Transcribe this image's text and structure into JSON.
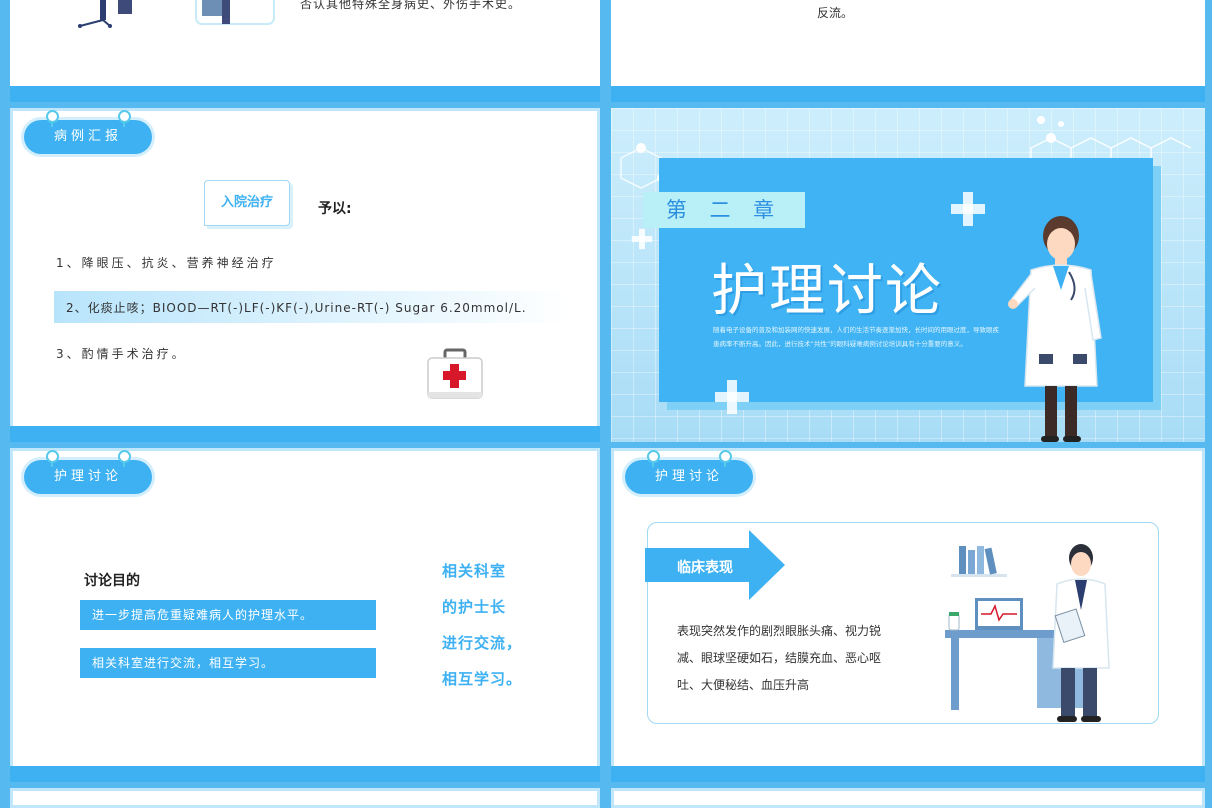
{
  "slide_top_left": {
    "text": "否认其他特殊全身病史、外伤手术史。"
  },
  "slide_top_right": {
    "text": "反流。"
  },
  "slide_case": {
    "tag": "病例汇报",
    "box_label": "入院治疗",
    "give": "予以:",
    "items": [
      "1、降眼压、抗炎、营养神经治疗",
      "2、化痰止咳；BIOOD—RT(-)LF(-)KF(-),Urine-RT(-) Sugar 6.20mmol/L.",
      "3、酌情手术治疗。"
    ]
  },
  "slide_chapter": {
    "chapter_label": "第 二 章",
    "title": "护理讨论",
    "desc_line1": "随着电子设备的普及和加装网的快速发展，人们的生活节奏逐渐加快，长时间的用眼过度，导致眼疾",
    "desc_line2": "患病率不断升高。因此，进行技术“共性”的眼科疑难病例讨论培训具有十分重要的意义。"
  },
  "slide_discuss": {
    "tag": "护理讨论",
    "heading": "讨论目的",
    "bar1": "进一步提高危重疑难病人的护理水平。",
    "bar2": "相关科室进行交流，相互学习。",
    "side_lines": [
      "相关科室",
      "的护士长",
      "进行交流，",
      "相互学习。"
    ]
  },
  "slide_clinical": {
    "tag": "护理讨论",
    "arrow_label": "临床表现",
    "body_lines": [
      "表现突然发作的剧烈眼胀头痛、视力锐",
      "减、眼球坚硬如石，结膜充血、恶心呕",
      "吐、大便秘结、血压升高"
    ]
  },
  "colors": {
    "accent": "#3eb1f2",
    "border": "#bfe6fb",
    "dark_text": "#333333",
    "highlight_text": "#3eb1f2"
  }
}
